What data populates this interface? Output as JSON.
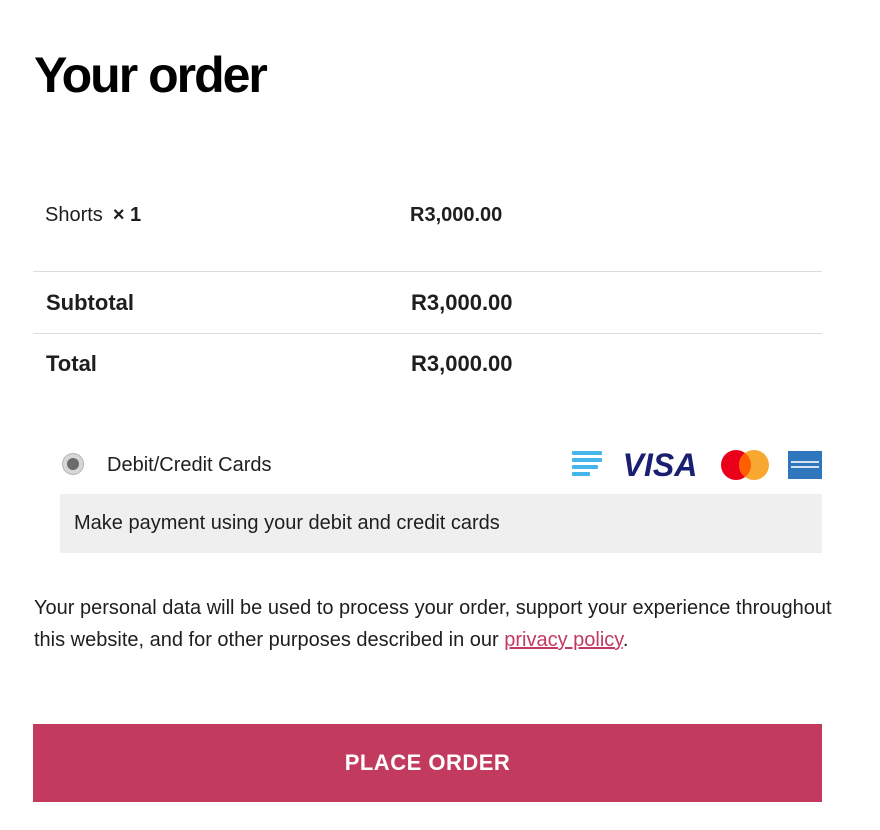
{
  "heading": "Your order",
  "items": [
    {
      "name": "Shorts",
      "qty": "× 1",
      "price": "R3,000.00"
    }
  ],
  "subtotal": {
    "label": "Subtotal",
    "value": "R3,000.00"
  },
  "total": {
    "label": "Total",
    "value": "R3,000.00"
  },
  "payment": {
    "method_label": "Debit/Credit Cards",
    "description": "Make payment using your debit and credit cards",
    "card_icons": [
      "card-stack-icon",
      "visa-icon",
      "mastercard-icon",
      "amex-icon"
    ],
    "visa_text": "VISA",
    "colors": {
      "visa_blue": "#1a1f71",
      "stack_blue": "#45b5ea",
      "mc_red": "#eb001b",
      "mc_orange": "#f79e1b",
      "amex_blue": "#2e77bc"
    }
  },
  "privacy": {
    "text_before": "Your personal data will be used to process your order, support your experience throughout this website, and for other purposes described in our ",
    "link_text": "privacy policy",
    "text_after": "."
  },
  "place_order_label": "PLACE ORDER",
  "colors": {
    "accent": "#c23a5e",
    "desc_bg": "#efefef",
    "separator": "#dcdcdc"
  }
}
